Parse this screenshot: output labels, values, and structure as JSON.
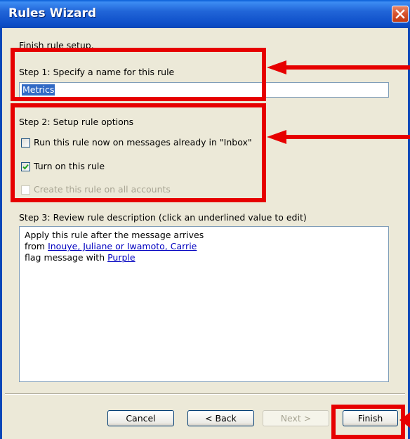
{
  "window": {
    "title": "Rules Wizard"
  },
  "intro": "Finish rule setup.",
  "step1": {
    "label": "Step 1: Specify a name for this rule",
    "name_value": "Metrics"
  },
  "step2": {
    "label": "Step 2: Setup rule options",
    "options": [
      {
        "label": "Run this rule now on messages already in \"Inbox\"",
        "checked": false,
        "enabled": true
      },
      {
        "label": "Turn on this rule",
        "checked": true,
        "enabled": true
      },
      {
        "label": "Create this rule on all accounts",
        "checked": false,
        "enabled": false
      }
    ]
  },
  "step3": {
    "label": "Step 3: Review rule description (click an underlined value to edit)",
    "line1": "Apply this rule after the message arrives",
    "line2_prefix": "from ",
    "line2_link": "Inouye, Juliane or Iwamoto, Carrie",
    "line3_prefix": "flag message with ",
    "line3_link": "Purple"
  },
  "buttons": {
    "cancel": "Cancel",
    "back": "< Back",
    "next": "Next >",
    "finish": "Finish"
  },
  "colors": {
    "annotation": "#E60000",
    "titlebar": "#0D4EC8",
    "link": "#0000C0"
  },
  "icons": {
    "close": "close-icon",
    "check": "checkmark-icon"
  }
}
